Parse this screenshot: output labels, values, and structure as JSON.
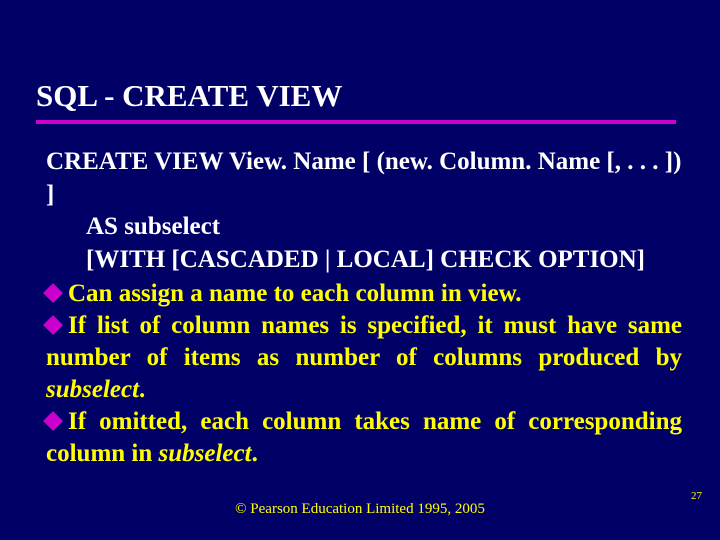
{
  "title": "SQL - CREATE VIEW",
  "syntax": {
    "line1": "CREATE VIEW View. Name [ (new. Column. Name [, . . . ]) ]",
    "line2": "AS subselect",
    "line3": "[WITH [CASCADED | LOCAL] CHECK OPTION]"
  },
  "bullets": {
    "b1": "Can assign a name to each column in view.",
    "b2_a": "If list of column names is specified, it must have same number of items as number of columns produced by ",
    "b2_b": "subselect",
    "b2_c": ".",
    "b3_a": "If omitted, each column takes name of corresponding column in ",
    "b3_b": "subselect",
    "b3_c": "."
  },
  "footer": "© Pearson Education Limited 1995, 2005",
  "page_number": "27"
}
